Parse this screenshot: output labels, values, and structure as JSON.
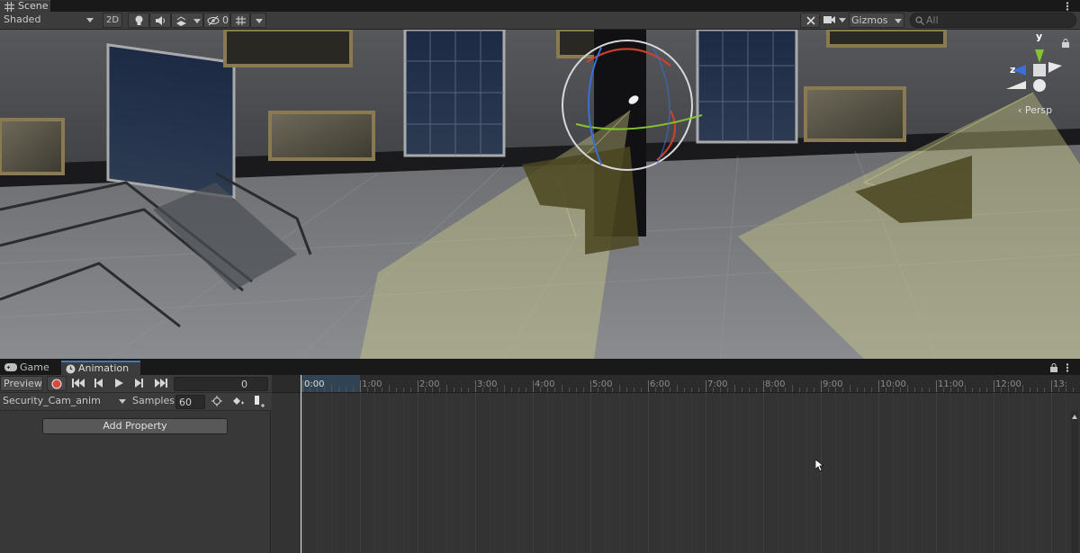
{
  "scene_tab": {
    "label": "Scene"
  },
  "toolbar": {
    "draw_mode": "Shaded",
    "mode_2d": "2D",
    "hidden_count": "0",
    "gizmos": "Gizmos",
    "search_placeholder": "All"
  },
  "viewport": {
    "projection_label": "‹ Persp",
    "axis_labels": {
      "y": "y",
      "z": "z"
    }
  },
  "panel_tabs": {
    "game": "Game",
    "animation": "Animation"
  },
  "animation": {
    "preview_label": "Preview",
    "frame": "0",
    "clip_name": "Security_Cam_anim",
    "samples_label": "Samples",
    "samples_value": "60",
    "add_property": "Add Property",
    "ticks": [
      "0:00",
      "1:00",
      "2:00",
      "3:00",
      "4:00",
      "5:00",
      "6:00",
      "7:00",
      "8:00",
      "9:00",
      "10:00",
      "11:00",
      "12:00",
      "13:"
    ]
  },
  "colors": {
    "accent": "#3a79bb",
    "record": "#d84a3a",
    "light_cone": "#d8d48a",
    "gizmo_x": "#d0402a",
    "gizmo_y": "#86c32d",
    "gizmo_z": "#3a6fd8"
  }
}
